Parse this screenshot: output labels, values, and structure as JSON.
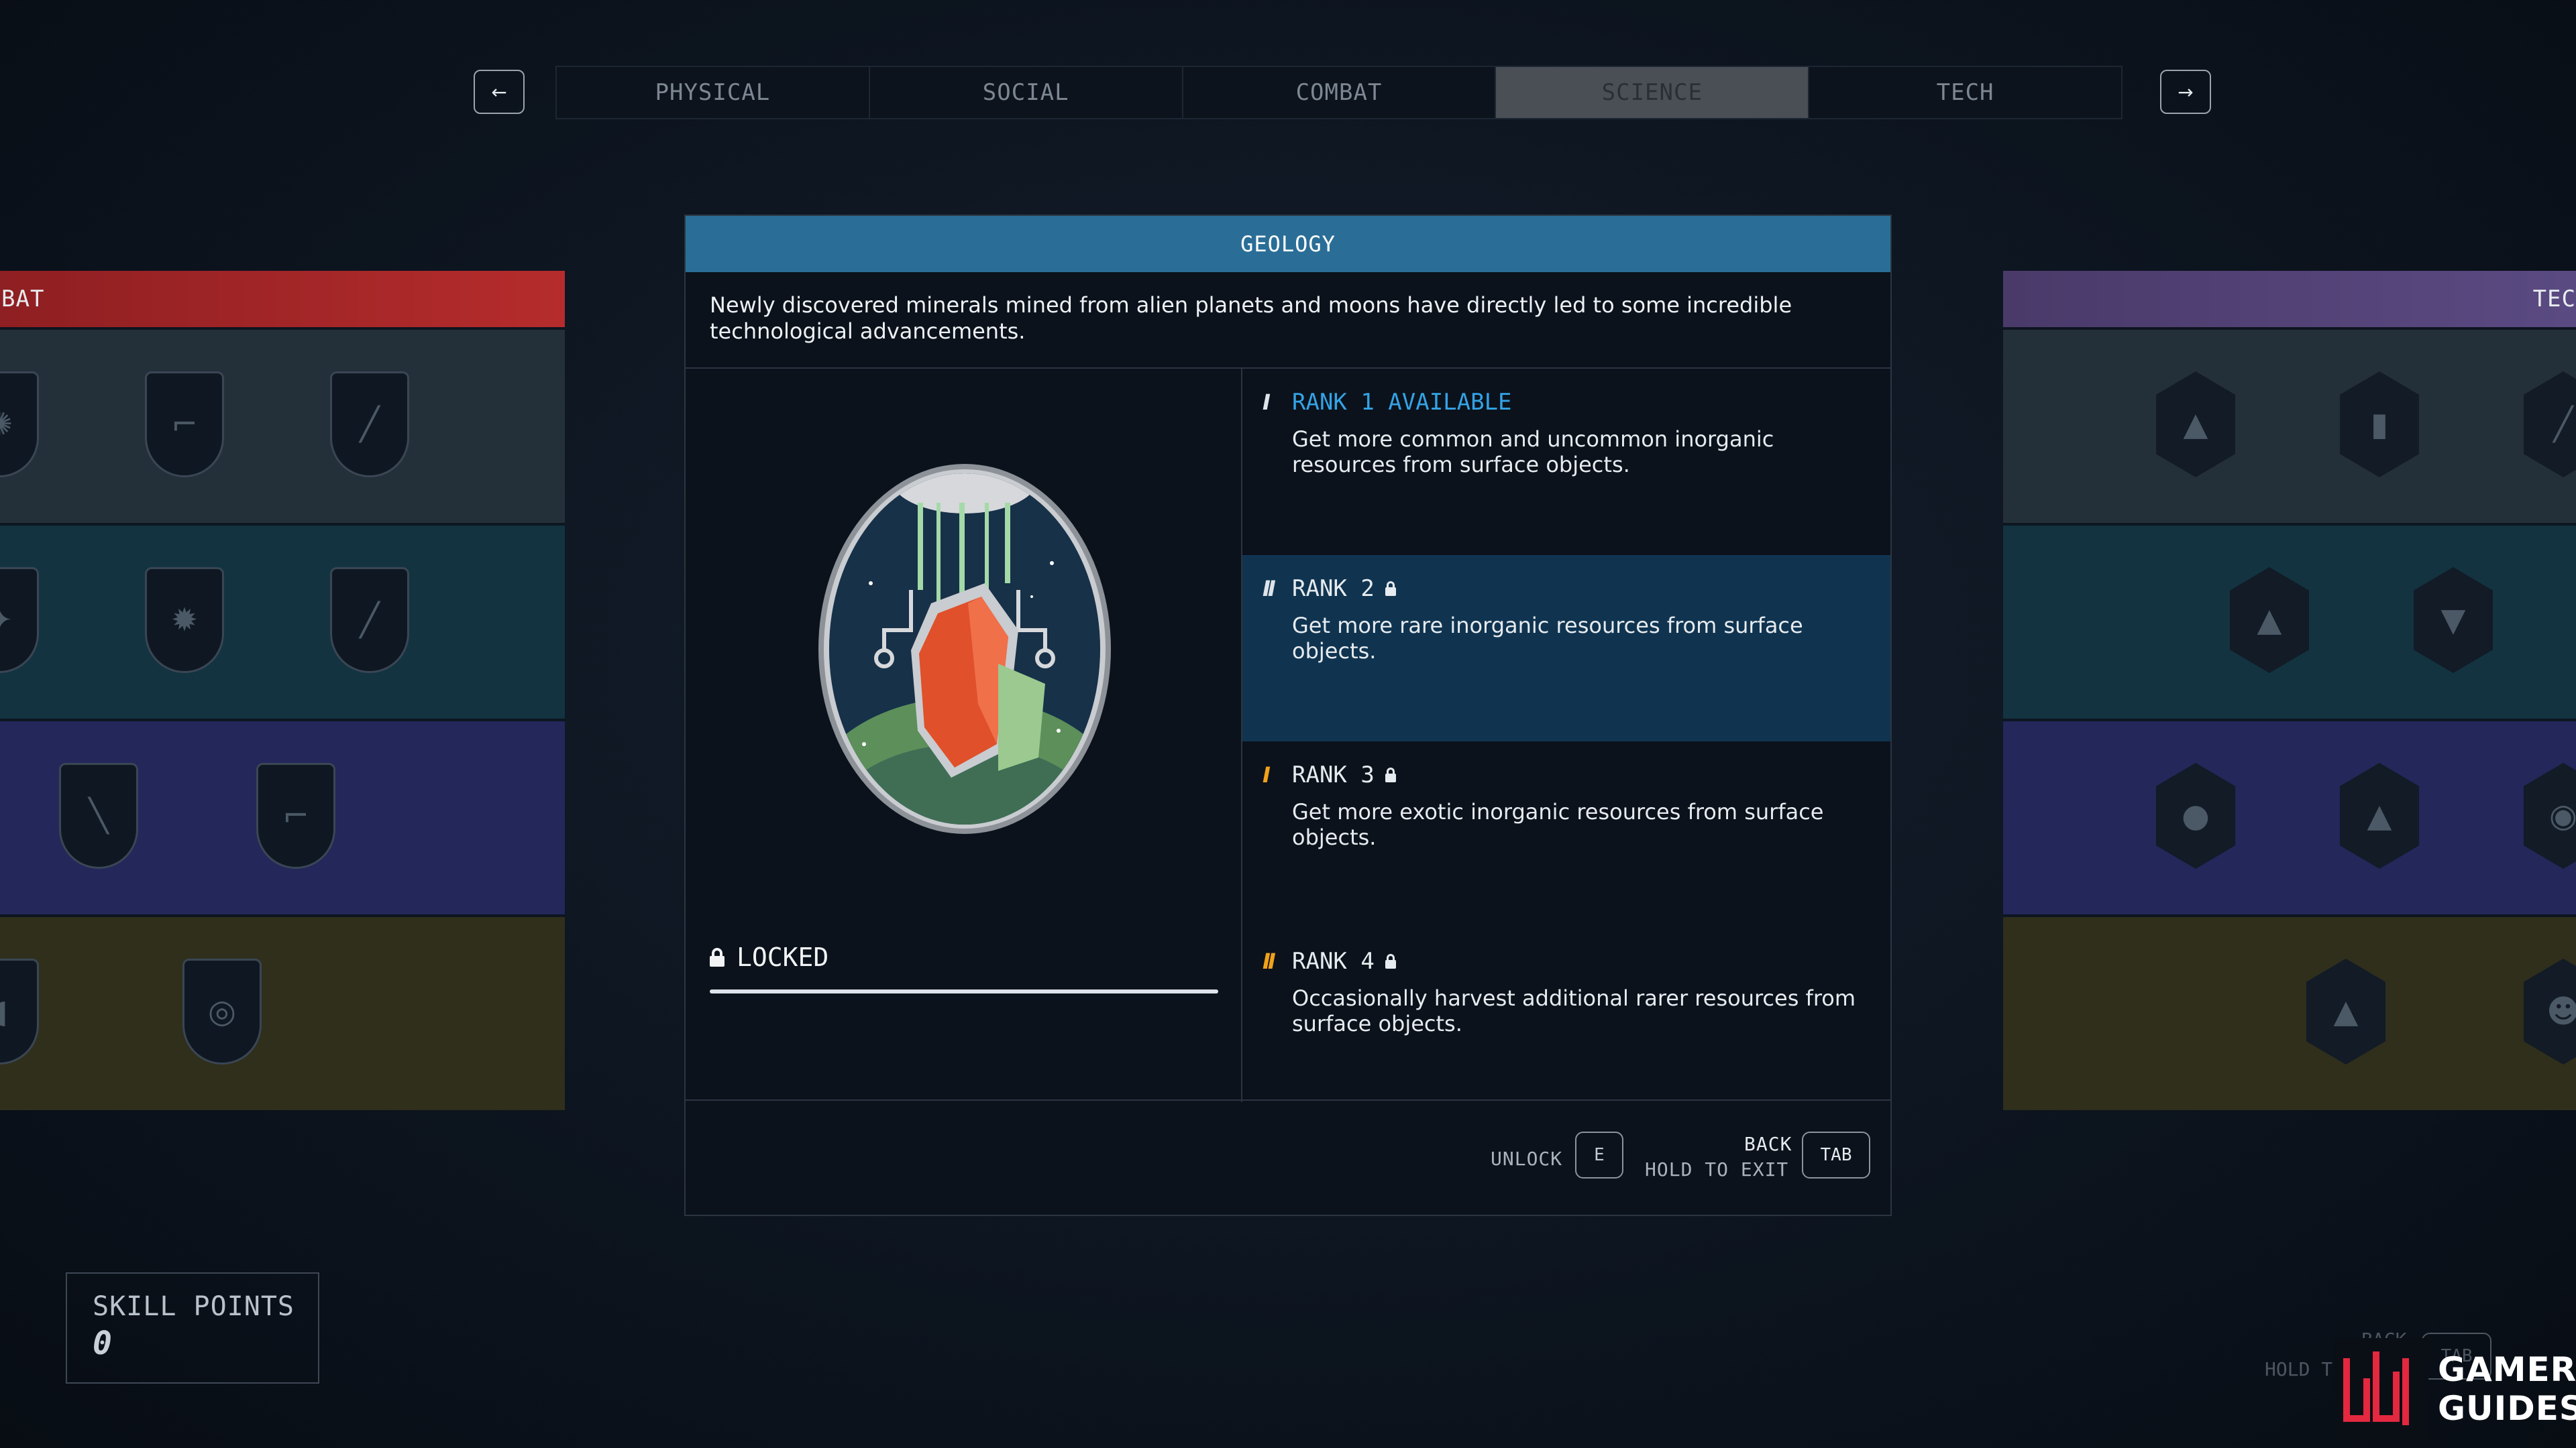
{
  "nav": {
    "prev_arrow": "←",
    "next_arrow": "→",
    "tabs": [
      {
        "label": "PHYSICAL"
      },
      {
        "label": "SOCIAL"
      },
      {
        "label": "COMBAT"
      },
      {
        "label": "SCIENCE",
        "active": true
      },
      {
        "label": "TECH"
      }
    ]
  },
  "left_column": {
    "header": "BAT",
    "header_color": "#8e1f22",
    "row_colors": [
      "#243039",
      "#133341",
      "#23275a",
      "#2f2f1c"
    ]
  },
  "right_column": {
    "header": "TEC",
    "header_color": "#4a3a6a",
    "row_colors": [
      "#243039",
      "#133341",
      "#23275a",
      "#2f2f1c"
    ]
  },
  "skill": {
    "title": "GEOLOGY",
    "header_color": "#2a6e97",
    "description": "Newly discovered minerals mined from alien planets and moons have directly led to some incredible technological advancements.",
    "status": "LOCKED",
    "progress": 1.0,
    "ranks": [
      {
        "marks": "I",
        "marks_color": "#dfe4ea",
        "title": "RANK 1 AVAILABLE",
        "desc": "Get more common and uncommon inorganic resources from surface objects."
      },
      {
        "marks": "II",
        "marks_color": "#dfe4ea",
        "title": "RANK 2",
        "desc": "Get more rare inorganic resources from surface objects."
      },
      {
        "marks": "I",
        "marks_color": "#f0a21a",
        "title": "RANK 3",
        "desc": "Get more exotic inorganic resources from surface objects."
      },
      {
        "marks": "II",
        "marks_color": "#f0a21a",
        "title": "RANK 4",
        "desc": "Occasionally harvest additional rarer resources from surface objects."
      }
    ]
  },
  "footer": {
    "unlock_label": "UNLOCK",
    "unlock_key": "E",
    "back_label": "BACK",
    "hold_label": "HOLD TO EXIT",
    "back_key": "TAB"
  },
  "skill_points": {
    "label": "SKILL POINTS",
    "value": "0"
  },
  "ghost_hint": {
    "back": "BACK",
    "hold": "HOLD T",
    "key": "TAB"
  },
  "watermark": {
    "line1": "GAMER",
    "line2": "GUIDES"
  }
}
